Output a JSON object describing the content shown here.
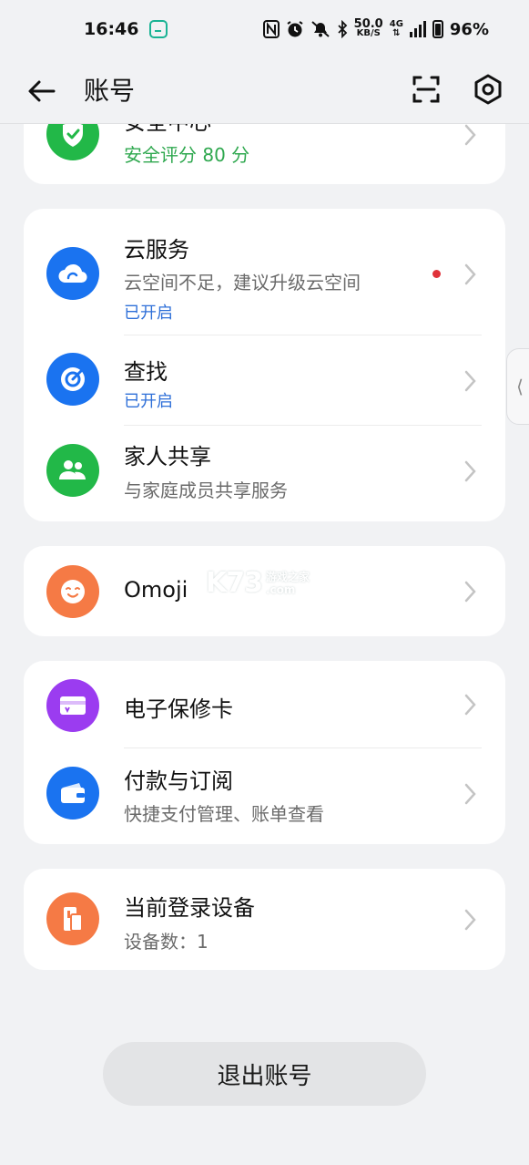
{
  "status_bar": {
    "time": "16:46",
    "net_speed_value": "50.0",
    "net_speed_unit": "KB/S",
    "network_type": "4G",
    "battery": "96%"
  },
  "header": {
    "title": "账号"
  },
  "security": {
    "title": "安全中心",
    "score": "安全评分 80 分"
  },
  "services": [
    {
      "title": "云服务",
      "subtitle": "云空间不足，建议升级云空间",
      "tag": "已开启"
    },
    {
      "title": "查找",
      "tag": "已开启"
    },
    {
      "title": "家人共享",
      "subtitle": "与家庭成员共享服务"
    }
  ],
  "omoji": {
    "title": "Omoji"
  },
  "payments": [
    {
      "title": "电子保修卡"
    },
    {
      "title": "付款与订阅",
      "subtitle": "快捷支付管理、账单查看"
    }
  ],
  "devices": {
    "title": "当前登录设备",
    "subtitle": "设备数：1"
  },
  "logout_label": "退出账号",
  "watermark": {
    "logo": "K73",
    "line1": "游戏之家",
    "line2": ".com"
  },
  "side_handle": "⟨",
  "colors": {
    "background": "#f1f2f4",
    "blue": "#1a73f0",
    "green": "#22b848",
    "orange": "#f57a45",
    "purple": "#9b3cf0",
    "tag_blue": "#2e6fd8",
    "score_green": "#2fa84f",
    "red_dot": "#e0323a"
  },
  "icons": {
    "security": "shield-check-icon",
    "cloud": "cloud-icon",
    "find": "radar-icon",
    "family": "people-icon",
    "omoji": "smiley-face-icon",
    "warranty": "warranty-card-icon",
    "payment": "wallet-icon",
    "devices": "devices-icon"
  }
}
